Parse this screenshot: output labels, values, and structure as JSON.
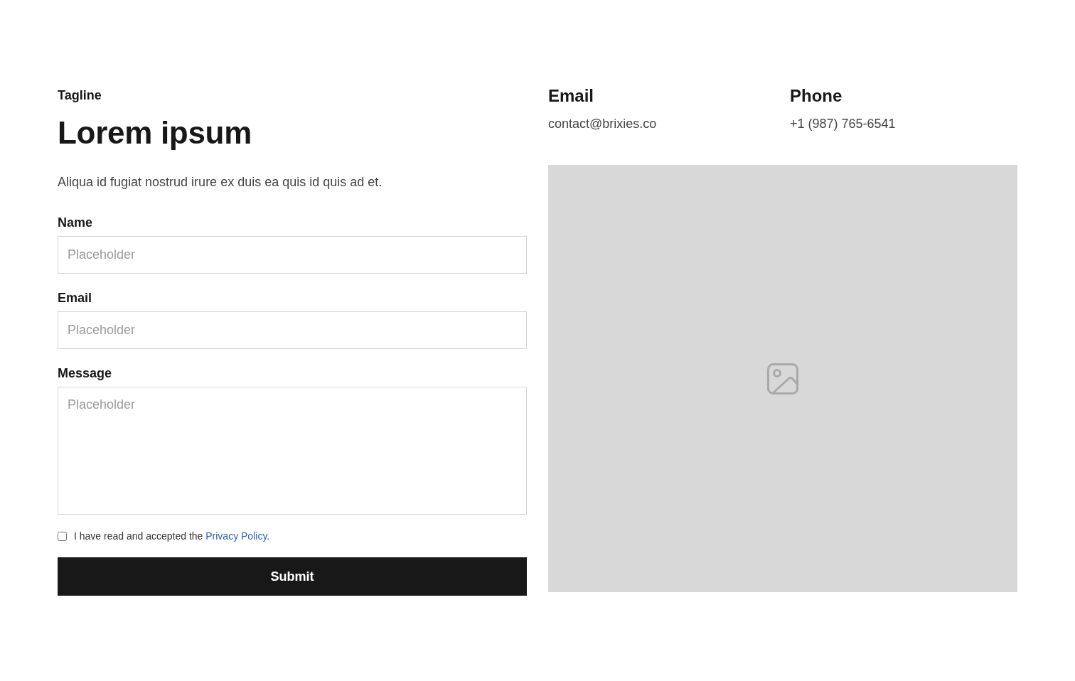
{
  "tagline": "Tagline",
  "heading": "Lorem ipsum",
  "description": "Aliqua id fugiat nostrud irure ex duis ea quis id quis ad et.",
  "form": {
    "fields": [
      {
        "label": "Name",
        "placeholder": "Placeholder",
        "kind": "input"
      },
      {
        "label": "Email",
        "placeholder": "Placeholder",
        "kind": "input"
      },
      {
        "label": "Message",
        "placeholder": "Placeholder",
        "kind": "textarea"
      }
    ],
    "consent": {
      "text": "I have read and accepted the ",
      "link": "Privacy Policy",
      "suffix": ".",
      "checked": false
    },
    "submit": "Submit"
  },
  "contacts": [
    {
      "label": "Email",
      "value": "contact@brixies.co"
    },
    {
      "label": "Phone",
      "value": "+1 (987) 765-6541"
    }
  ]
}
